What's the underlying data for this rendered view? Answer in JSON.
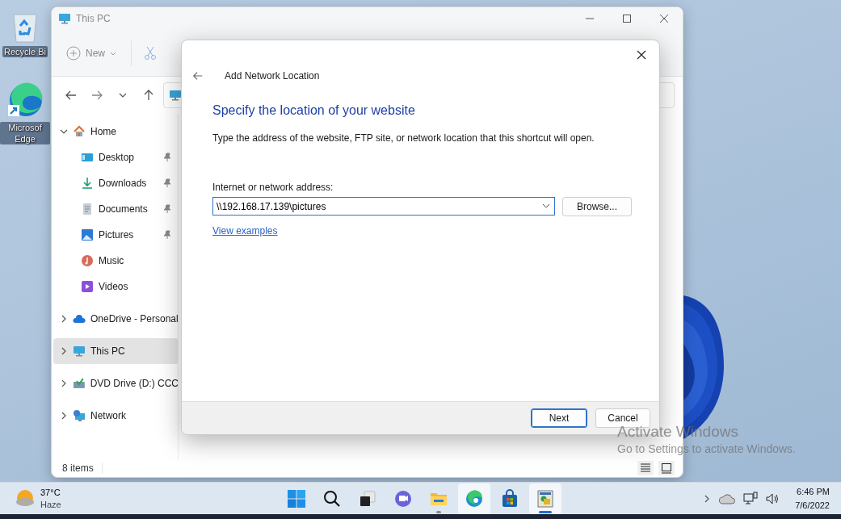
{
  "desktop_icons": [
    {
      "kind": "recycle",
      "label": "Recycle Bi"
    },
    {
      "kind": "edge",
      "label": "Microsof Edge"
    }
  ],
  "explorer": {
    "title": "This PC",
    "toolbar": {
      "new_label": "New"
    },
    "sidebar": [
      {
        "label": "Home",
        "kind": "home",
        "expanded": true,
        "selected": false,
        "children": [
          {
            "label": "Desktop",
            "kind": "desktop",
            "pinned": true,
            "selected": false
          },
          {
            "label": "Downloads",
            "kind": "download",
            "pinned": true,
            "selected": false
          },
          {
            "label": "Documents",
            "kind": "document",
            "pinned": true,
            "selected": false
          },
          {
            "label": "Pictures",
            "kind": "pictures",
            "pinned": true,
            "selected": false
          },
          {
            "label": "Music",
            "kind": "music",
            "pinned": false,
            "selected": false
          },
          {
            "label": "Videos",
            "kind": "videos",
            "pinned": false,
            "selected": false
          }
        ]
      },
      {
        "label": "OneDrive - Personal",
        "kind": "cloud",
        "expanded": false,
        "selected": false
      },
      {
        "label": "This PC",
        "kind": "pc",
        "expanded": false,
        "selected": true
      },
      {
        "label": "DVD Drive (D:) CCC",
        "kind": "dvd",
        "expanded": false,
        "selected": false
      },
      {
        "label": "Network",
        "kind": "network",
        "expanded": false,
        "selected": false
      }
    ],
    "status": "8 items"
  },
  "dialog": {
    "title": "Add Network Location",
    "heading": "Specify the location of your website",
    "description": "Type the address of the website, FTP site, or network location that this shortcut will open.",
    "address_label": "Internet or network address:",
    "address_value": "\\\\192.168.17.139\\pictures",
    "browse": "Browse...",
    "link": "View examples",
    "buttons": [
      {
        "label": "Next",
        "default": true
      },
      {
        "label": "Cancel",
        "default": false
      }
    ]
  },
  "watermark": {
    "title": "Activate Windows",
    "subtitle": "Go to Settings to activate Windows."
  },
  "taskbar": {
    "weather": {
      "temperature": "37°C",
      "condition": "Haze"
    },
    "apps": [
      {
        "kind": "start",
        "highlighted": false,
        "open": false,
        "focused": false
      },
      {
        "kind": "search",
        "highlighted": false,
        "open": false,
        "focused": false
      },
      {
        "kind": "taskview",
        "highlighted": false,
        "open": false,
        "focused": false
      },
      {
        "kind": "chat",
        "highlighted": false,
        "open": false,
        "focused": false
      },
      {
        "kind": "explorer",
        "highlighted": false,
        "open": true,
        "focused": false
      },
      {
        "kind": "edge",
        "highlighted": true,
        "open": false,
        "focused": false
      },
      {
        "kind": "store",
        "highlighted": false,
        "open": false,
        "focused": false
      },
      {
        "kind": "app",
        "highlighted": true,
        "open": true,
        "focused": true
      }
    ],
    "time": "6:46 PM",
    "date": "7/6/2022"
  }
}
